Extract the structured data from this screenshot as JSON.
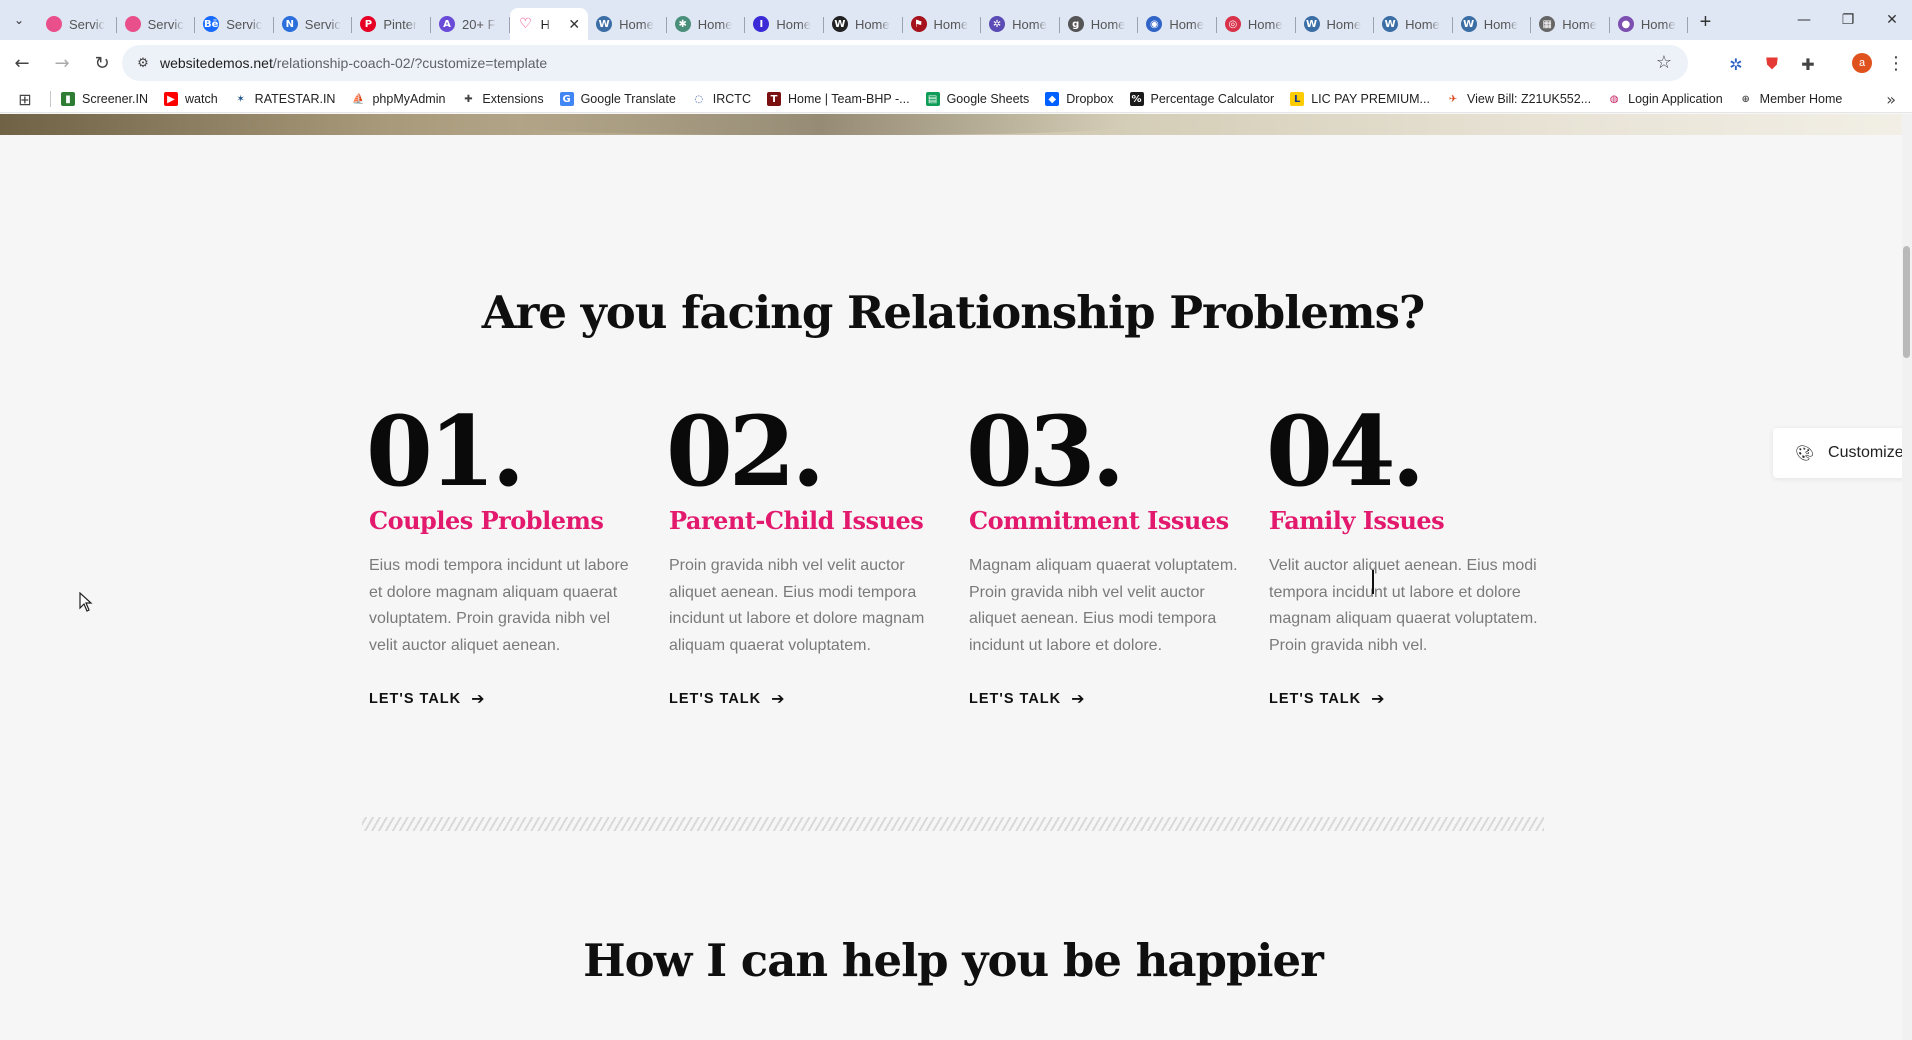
{
  "browser": {
    "tabs": [
      {
        "label": "Servic",
        "icon": "dribbble-icon",
        "color": "#e94f8b"
      },
      {
        "label": "Servic",
        "icon": "dribbble-icon",
        "color": "#e94f8b"
      },
      {
        "label": "Servic",
        "icon": "behance-icon",
        "color": "#1769ff",
        "glyph": "Bē"
      },
      {
        "label": "Servic",
        "icon": "n-logo-icon",
        "color": "#2a6fdb",
        "glyph": "N"
      },
      {
        "label": "Pinter",
        "icon": "pinterest-icon",
        "color": "#e60023",
        "glyph": "P"
      },
      {
        "label": "20+ F",
        "icon": "a-logo-icon",
        "color": "#6a4bd8",
        "glyph": "A"
      },
      {
        "label": "H",
        "icon": "relationship-logo-icon",
        "color": "#e3196e",
        "active": true
      },
      {
        "label": "Home",
        "icon": "wordpress-icon",
        "color": "#3b6ea5",
        "glyph": "W"
      },
      {
        "label": "Home",
        "icon": "leaf-icon",
        "color": "#4a8f7a",
        "glyph": "✱"
      },
      {
        "label": "Home",
        "icon": "i-logo-icon",
        "color": "#3a2bd6",
        "glyph": "I"
      },
      {
        "label": "Home",
        "icon": "w-logo-icon",
        "color": "#222222",
        "glyph": "W"
      },
      {
        "label": "Home",
        "icon": "flag-icon",
        "color": "#a5121c",
        "glyph": "⚑"
      },
      {
        "label": "Home",
        "icon": "sparkle-icon",
        "color": "#5a4bb5",
        "glyph": "✲"
      },
      {
        "label": "Home",
        "icon": "gd-logo-icon",
        "color": "#555555",
        "glyph": "g"
      },
      {
        "label": "Home",
        "icon": "globe-icon",
        "color": "#3164c7",
        "glyph": "◉"
      },
      {
        "label": "Home",
        "icon": "swirl-icon",
        "color": "#d8334a",
        "glyph": "◎"
      },
      {
        "label": "Home",
        "icon": "wordpress-icon",
        "color": "#3b6ea5",
        "glyph": "W"
      },
      {
        "label": "Home",
        "icon": "wordpress-icon",
        "color": "#3b6ea5",
        "glyph": "W"
      },
      {
        "label": "Home",
        "icon": "wordpress-icon",
        "color": "#3b6ea5",
        "glyph": "W"
      },
      {
        "label": "Home",
        "icon": "layout-icon",
        "color": "#666666",
        "glyph": "▦"
      },
      {
        "label": "Home",
        "icon": "blob-icon",
        "color": "#7c4fb0",
        "glyph": "●"
      }
    ],
    "new_tab": "+",
    "url_host": "websitedemos.net",
    "url_path": "/relationship-coach-02/?customize=template",
    "avatar_letter": "a",
    "bookmarks": [
      {
        "label": "Screener.IN",
        "icon": "bar-chart-icon",
        "color": "#2e7d32",
        "glyph": "▮"
      },
      {
        "label": "watch",
        "icon": "youtube-icon",
        "color": "#ff0000",
        "glyph": "▶"
      },
      {
        "label": "RATESTAR.IN",
        "icon": "ratestar-icon",
        "color": "#ffffff",
        "glyph": "✶",
        "fg": "#1a4f8a"
      },
      {
        "label": "phpMyAdmin",
        "icon": "phpmyadmin-icon",
        "color": "#ffffff",
        "glyph": "⛵",
        "fg": "#f29111"
      },
      {
        "label": "Extensions",
        "icon": "puzzle-icon",
        "color": "#ffffff",
        "glyph": "✚",
        "fg": "#444444"
      },
      {
        "label": "Google Translate",
        "icon": "translate-icon",
        "color": "#4285f4",
        "glyph": "G"
      },
      {
        "label": "IRCTC",
        "icon": "irctc-icon",
        "color": "#ffffff",
        "glyph": "◌",
        "fg": "#1d3f8f"
      },
      {
        "label": "Home | Team-BHP -...",
        "icon": "team-bhp-icon",
        "color": "#7a1010",
        "glyph": "T"
      },
      {
        "label": "Google Sheets",
        "icon": "sheets-icon",
        "color": "#0f9d58",
        "glyph": "▤"
      },
      {
        "label": "Dropbox",
        "icon": "dropbox-icon",
        "color": "#0061fe",
        "glyph": "◆"
      },
      {
        "label": "Percentage Calculator",
        "icon": "calculator-icon",
        "color": "#1a1a1a",
        "glyph": "%"
      },
      {
        "label": "LIC PAY PREMIUM...",
        "icon": "lic-icon",
        "color": "#ffcc00",
        "glyph": "L",
        "fg": "#1a3a8a"
      },
      {
        "label": "View Bill: Z21UK552...",
        "icon": "bill-icon",
        "color": "#ffffff",
        "glyph": "✈",
        "fg": "#d84315"
      },
      {
        "label": "Login Application",
        "icon": "login-icon",
        "color": "#ffffff",
        "glyph": "◍",
        "fg": "#c2185b"
      },
      {
        "label": "Member Home",
        "icon": "globe-icon",
        "color": "#ffffff",
        "glyph": "⊕",
        "fg": "#555555"
      }
    ]
  },
  "page": {
    "section1_title": "Are you facing Relationship Problems?",
    "cards": [
      {
        "num": "01.",
        "title": "Couples Problems",
        "desc": "Eius modi tempora incidunt ut labore et dolore magnam aliquam quaerat voluptatem. Proin gravida nibh vel velit auctor aliquet aenean.",
        "cta": "LET'S TALK"
      },
      {
        "num": "02.",
        "title": "Parent-Child Issues",
        "desc": "Proin gravida nibh vel velit auctor aliquet aenean. Eius modi tempora incidunt ut labore et dolore magnam aliquam quaerat voluptatem.",
        "cta": "LET'S TALK"
      },
      {
        "num": "03.",
        "title": "Commitment Issues",
        "desc": "Magnam aliquam quaerat voluptatem. Proin gravida nibh vel velit auctor aliquet aenean. Eius modi tempora incidunt ut labore et dolore.",
        "cta": "LET'S TALK"
      },
      {
        "num": "04.",
        "title": "Family Issues",
        "desc": "Velit auctor aliquet aenean. Eius modi tempora incidunt ut labore et dolore magnam aliquam quaerat voluptatem. Proin gravida nibh vel.",
        "cta": "LET'S TALK"
      }
    ],
    "section2_title": "How I can help you be happier",
    "customize_label": "Customize",
    "accent_color": "#e3196e"
  }
}
